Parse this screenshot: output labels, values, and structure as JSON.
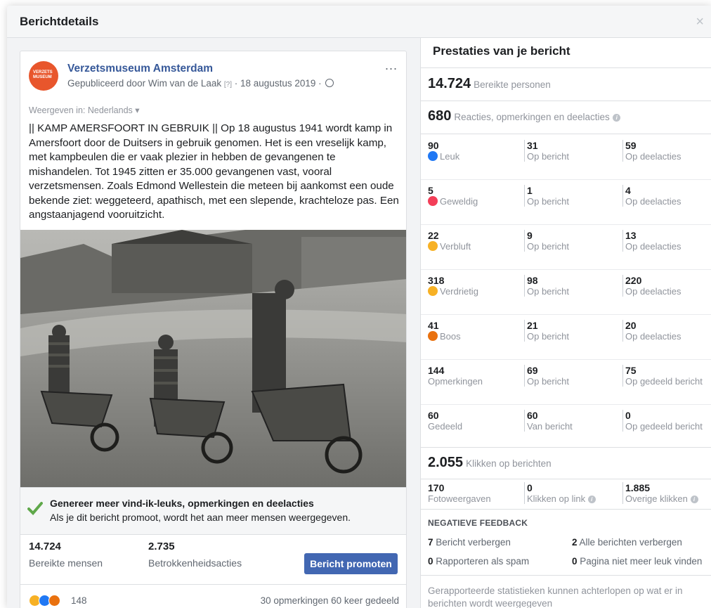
{
  "dialog": {
    "title": "Berichtdetails",
    "close": "×"
  },
  "post": {
    "avatar_text": "VERZETS MUSEUM",
    "page_name": "Verzetsmuseum Amsterdam",
    "byline": "Gepubliceerd door Wim van de Laak",
    "byline_q": "[?]",
    "byline_date": "· 18 augustus 2019 ·",
    "more": "...",
    "viewing": "Weergeven in: Nederlands ▾",
    "text": "|| KAMP AMERSFOORT IN GEBRUIK || Op 18 augustus 1941 wordt kamp in Amersfoort door de Duitsers in gebruik genomen. Het is een vreselijk kamp, met kampbeulen die er vaak plezier in hebben de gevangenen te mishandelen. Tot 1945 zitten er 35.000 gevangenen vast, vooral verzetsmensen. Zoals Edmond Wellestein die meteen bij aankomst een oude bekende ziet: weggeteerd, apathisch, met een slepende, krachteloze pas. Een angstaanjagend vooruitzicht.",
    "promote_title": "Genereer meer vind-ik-leuks, opmerkingen en deelacties",
    "promote_sub": "Als je dit bericht promoot, wordt het aan meer mensen weergegeven.",
    "reached_num": "14.724",
    "reached_label": "Bereikte mensen",
    "engagement_num": "2.735",
    "engagement_label": "Betrokkenheidsacties",
    "promote_button": "Bericht promoten",
    "reaction_count": "148",
    "comments_shares": "30 opmerkingen  60 keer gedeeld"
  },
  "performance": {
    "title": "Prestaties van je bericht",
    "reached_num": "14.724",
    "reached_label": "Bereikte personen",
    "reactions_num": "680",
    "reactions_label": "Reacties, opmerkingen en deelacties",
    "rows": [
      {
        "num": "90",
        "label": "Leuk",
        "icon": "like",
        "on_post": "31",
        "on_post_label": "Op bericht",
        "on_shares": "59",
        "on_shares_label": "Op deelacties"
      },
      {
        "num": "5",
        "label": "Geweldig",
        "icon": "love",
        "on_post": "1",
        "on_post_label": "Op bericht",
        "on_shares": "4",
        "on_shares_label": "Op deelacties"
      },
      {
        "num": "22",
        "label": "Verbluft",
        "icon": "wow",
        "on_post": "9",
        "on_post_label": "Op bericht",
        "on_shares": "13",
        "on_shares_label": "Op deelacties"
      },
      {
        "num": "318",
        "label": "Verdrietig",
        "icon": "sad",
        "on_post": "98",
        "on_post_label": "Op bericht",
        "on_shares": "220",
        "on_shares_label": "Op deelacties"
      },
      {
        "num": "41",
        "label": "Boos",
        "icon": "angry",
        "on_post": "21",
        "on_post_label": "Op bericht",
        "on_shares": "20",
        "on_shares_label": "Op deelacties"
      },
      {
        "num": "144",
        "label": "Opmerkingen",
        "icon": "",
        "on_post": "69",
        "on_post_label": "Op bericht",
        "on_shares": "75",
        "on_shares_label": "Op gedeeld bericht"
      },
      {
        "num": "60",
        "label": "Gedeeld",
        "icon": "",
        "on_post": "60",
        "on_post_label": "Van bericht",
        "on_shares": "0",
        "on_shares_label": "Op gedeeld bericht"
      }
    ],
    "clicks_num": "2.055",
    "clicks_label": "Klikken op berichten",
    "photo_views_num": "170",
    "photo_views_label": "Fotoweergaven",
    "link_clicks_num": "0",
    "link_clicks_label": "Klikken op link",
    "other_clicks_num": "1.885",
    "other_clicks_label": "Overige klikken",
    "negative_title": "NEGATIEVE FEEDBACK",
    "neg_hide_num": "7",
    "neg_hide_label": "Bericht verbergen",
    "neg_hide_all_num": "2",
    "neg_hide_all_label": "Alle berichten verbergen",
    "neg_spam_num": "0",
    "neg_spam_label": "Rapporteren als spam",
    "neg_unlike_num": "0",
    "neg_unlike_label": "Pagina niet meer leuk vinden",
    "footnote": "Gerapporteerde statistieken kunnen achterlopen op wat er in berichten wordt weergegeven"
  },
  "colors": {
    "brand_blue": "#4267b2",
    "link_blue": "#365899",
    "avatar_orange": "#e8562c"
  }
}
